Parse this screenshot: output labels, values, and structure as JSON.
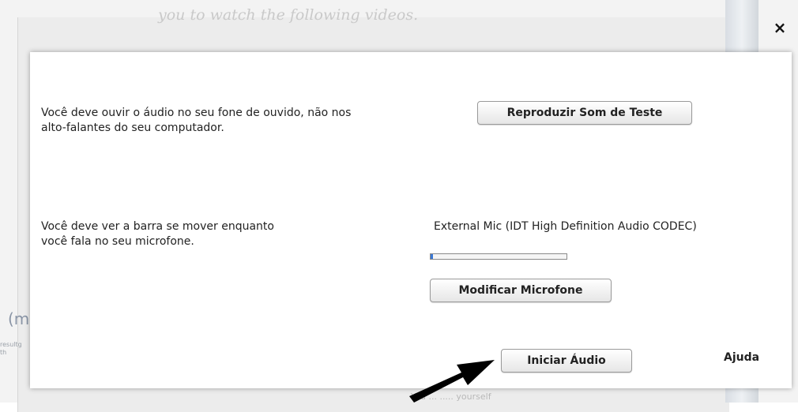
{
  "background": {
    "heading": "you to watch the following videos.",
    "fragment_big": "(m",
    "fragment_small": "resultg th",
    "fragment_bottom": "You ... ..... yourself"
  },
  "dialog": {
    "close_label": "×",
    "audio_test": {
      "text_line1": "Você deve ouvir o áudio no seu fone de ouvido, não nos",
      "text_line2": "alto-falantes do seu computador.",
      "button_label": "Reproduzir Som de Teste"
    },
    "mic_test": {
      "text_line1": "Você deve ver a barra se mover enquanto",
      "text_line2": "você fala no seu microfone.",
      "device_name": "External Mic (IDT High Definition Audio CODEC)",
      "level_fraction": 0.02,
      "button_label": "Modificar Microfone"
    },
    "start_button_label": "Iniciar Áudio",
    "help_label": "Ajuda"
  },
  "colors": {
    "level_fill": "#3a78d4",
    "arrow": "#000000"
  }
}
